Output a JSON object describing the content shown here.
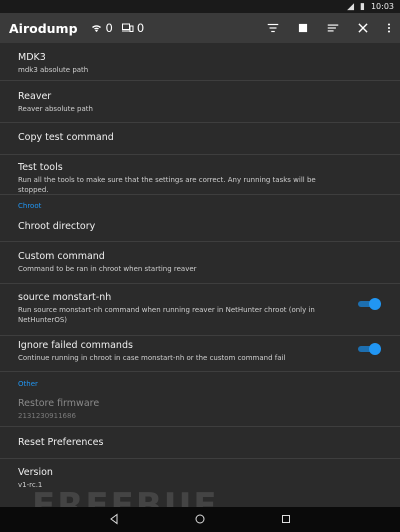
{
  "status_bar": {
    "time": "10:03"
  },
  "app_bar": {
    "title": "Airodump",
    "wifi_count": "0",
    "device_count": "0"
  },
  "settings": {
    "mdk3": {
      "title": "MDK3",
      "summary": "mdk3 absolute path"
    },
    "reaver": {
      "title": "Reaver",
      "summary": "Reaver absolute path"
    },
    "copy_test": {
      "title": "Copy test command"
    },
    "test_tools": {
      "title": "Test tools",
      "summary": "Run all the tools to make sure that the settings are correct. Any running tasks will be stopped."
    },
    "chroot_header": "Chroot",
    "chroot_dir": {
      "title": "Chroot directory"
    },
    "custom_command": {
      "title": "Custom command",
      "summary": "Command to be ran in chroot when starting reaver"
    },
    "source_monstart": {
      "title": "source monstart-nh",
      "summary": "Run source monstart-nh command when running reaver in NetHunter chroot (only in NetHunterOS)",
      "enabled": true
    },
    "ignore_failed": {
      "title": "Ignore failed commands",
      "summary": "Continue running in chroot in case monstart-nh or the custom command fail",
      "enabled": true
    },
    "other_header": "Other",
    "restore_firmware": {
      "title": "Restore firmware",
      "summary": "2131230911686"
    },
    "reset_prefs": {
      "title": "Reset Preferences"
    },
    "version": {
      "title": "Version",
      "summary": "v1-rc.1"
    }
  },
  "watermark": "FREEBUF",
  "colors": {
    "accent": "#2196f3",
    "background": "#2b2b2b",
    "app_bar": "#3a3a3a"
  },
  "icons": [
    "wifi-icon",
    "devices-icon",
    "filter-icon",
    "stop-icon",
    "sort-icon",
    "close-icon",
    "overflow-menu-icon",
    "back-icon",
    "home-icon",
    "recents-icon"
  ]
}
